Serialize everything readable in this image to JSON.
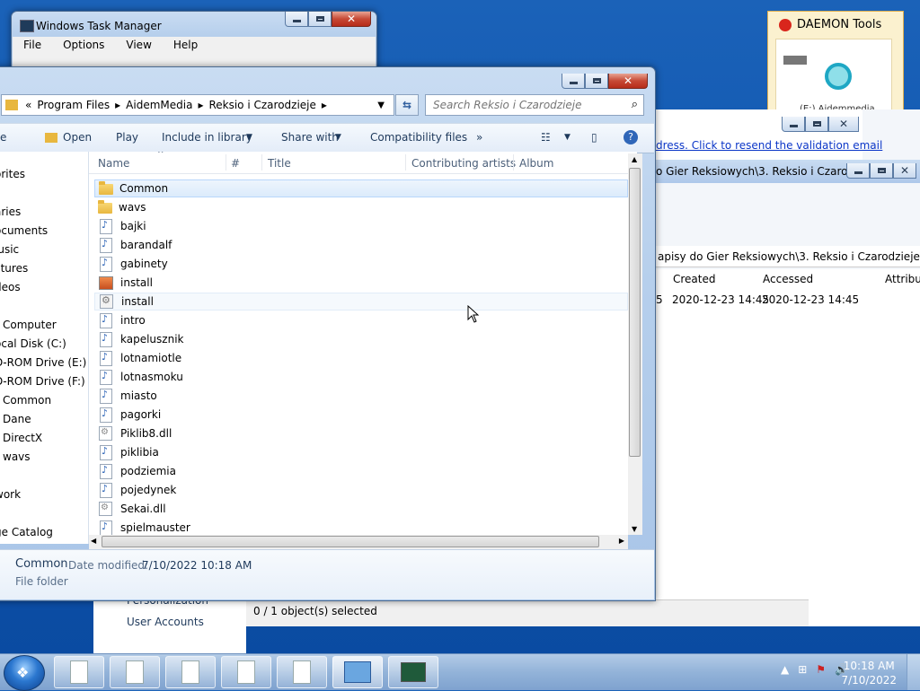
{
  "task_manager": {
    "title": "Windows Task Manager",
    "menu": [
      "File",
      "Options",
      "View",
      "Help"
    ]
  },
  "daemon": {
    "title": "DAEMON Tools",
    "drive_label": "(E:) Aidemmedia"
  },
  "right_window": {
    "link_text": "dress. Click to resend the validation email",
    "title": "o Gier Reksiowych\\3. Reksio i Czarod...",
    "path": "apisy do Gier Reksiowych\\3. Reksio i Czarodzieje\\",
    "col_created": "Created",
    "col_accessed": "Accessed",
    "col_attrib": "Attribu",
    "row_frag": "5",
    "row_created": "2020-12-23 14:45",
    "row_accessed": "2020-12-23 14:45"
  },
  "control_panel": {
    "item1": "Personalization",
    "item2": "User Accounts"
  },
  "status_bar": {
    "text": "0 / 1 object(s) selected"
  },
  "explorer": {
    "breadcrumb": [
      "«",
      "Program Files",
      "AidemMedia",
      "Reksio i Czarodzieje"
    ],
    "search_placeholder": "Search Reksio i Czarodzieje",
    "commands": {
      "organize": "e",
      "open": "Open",
      "play": "Play",
      "include": "Include in library",
      "share": "Share with",
      "compat": "Compatibility files",
      "more": "»"
    },
    "nav": [
      "orites",
      "aries",
      "ocuments",
      "lusic",
      "ctures",
      "deos",
      "Computer",
      "ocal Disk (C:)",
      "D-ROM Drive (E:) A",
      "D-ROM Drive (F:) A",
      "Common",
      "Dane",
      "DirectX",
      "wavs",
      "work",
      "ge Catalog"
    ],
    "columns": {
      "name": "Name",
      "num": "#",
      "title": "Title",
      "artists": "Contributing artists",
      "album": "Album"
    },
    "files": [
      {
        "name": "Common",
        "icon": "folder-icon"
      },
      {
        "name": "wavs",
        "icon": "folder-icon"
      },
      {
        "name": "bajki",
        "icon": "audio-file-icon"
      },
      {
        "name": "barandalf",
        "icon": "audio-file-icon"
      },
      {
        "name": "gabinety",
        "icon": "audio-file-icon"
      },
      {
        "name": "install",
        "icon": "app-icon"
      },
      {
        "name": "install",
        "icon": "setup-file-icon"
      },
      {
        "name": "intro",
        "icon": "audio-file-icon"
      },
      {
        "name": "kapelusznik",
        "icon": "audio-file-icon"
      },
      {
        "name": "lotnamiotle",
        "icon": "audio-file-icon"
      },
      {
        "name": "lotnasmoku",
        "icon": "audio-file-icon"
      },
      {
        "name": "miasto",
        "icon": "audio-file-icon"
      },
      {
        "name": "pagorki",
        "icon": "audio-file-icon"
      },
      {
        "name": "Piklib8.dll",
        "icon": "dll-file-icon"
      },
      {
        "name": "piklibia",
        "icon": "audio-file-icon"
      },
      {
        "name": "podziemia",
        "icon": "audio-file-icon"
      },
      {
        "name": "pojedynek",
        "icon": "audio-file-icon"
      },
      {
        "name": "Sekai.dll",
        "icon": "dll-file-icon"
      },
      {
        "name": "spielmauster",
        "icon": "audio-file-icon"
      }
    ],
    "details": {
      "name": "Common",
      "date_label": "Date modified:",
      "date_value": "7/10/2022 10:18 AM",
      "type": "File folder"
    }
  },
  "taskbar": {
    "time": "10:18 AM",
    "date": "7/10/2022"
  }
}
